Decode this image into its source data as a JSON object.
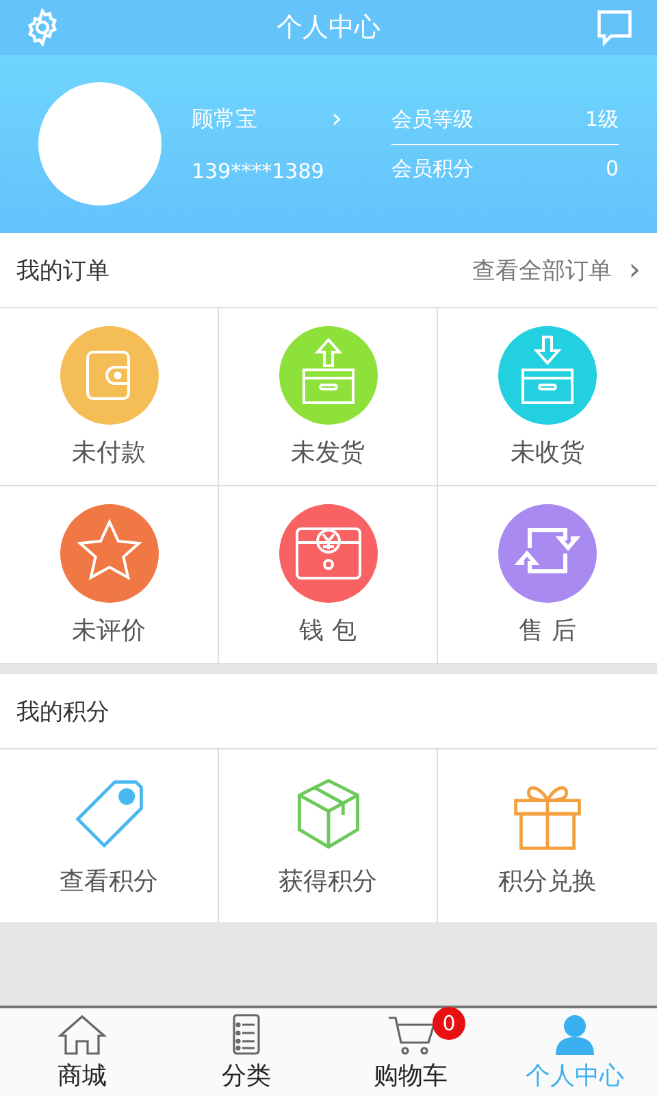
{
  "header": {
    "title": "个人中心"
  },
  "profile": {
    "name": "顾常宝",
    "arrow": "›",
    "phone": "139****1389",
    "stats": [
      {
        "label": "会员等级",
        "value": "1级"
      },
      {
        "label": "会员积分",
        "value": "0"
      }
    ]
  },
  "orders": {
    "title": "我的订单",
    "link": "查看全部订单",
    "link_arrow": "›",
    "items": [
      {
        "label": "未付款",
        "kind": "wallet",
        "color": "#f5bd55"
      },
      {
        "label": "未发货",
        "kind": "ship",
        "color": "#8ee03a"
      },
      {
        "label": "未收货",
        "kind": "receive",
        "color": "#22d0e0"
      },
      {
        "label": "未评价",
        "kind": "star",
        "color": "#f07845"
      },
      {
        "label": "钱 包",
        "kind": "purse",
        "color": "#f86262"
      },
      {
        "label": "售 后",
        "kind": "return",
        "color": "#a98af0"
      }
    ]
  },
  "points": {
    "title": "我的积分",
    "items": [
      {
        "label": "查看积分",
        "kind": "tag"
      },
      {
        "label": "获得积分",
        "kind": "box"
      },
      {
        "label": "积分兑换",
        "kind": "gift"
      }
    ]
  },
  "tabbar": [
    {
      "label": "商城",
      "kind": "home",
      "selected": false
    },
    {
      "label": "分类",
      "kind": "list",
      "selected": false
    },
    {
      "label": "购物车",
      "kind": "cart",
      "selected": false,
      "badge": "0"
    },
    {
      "label": "个人中心",
      "kind": "person",
      "selected": true
    }
  ]
}
